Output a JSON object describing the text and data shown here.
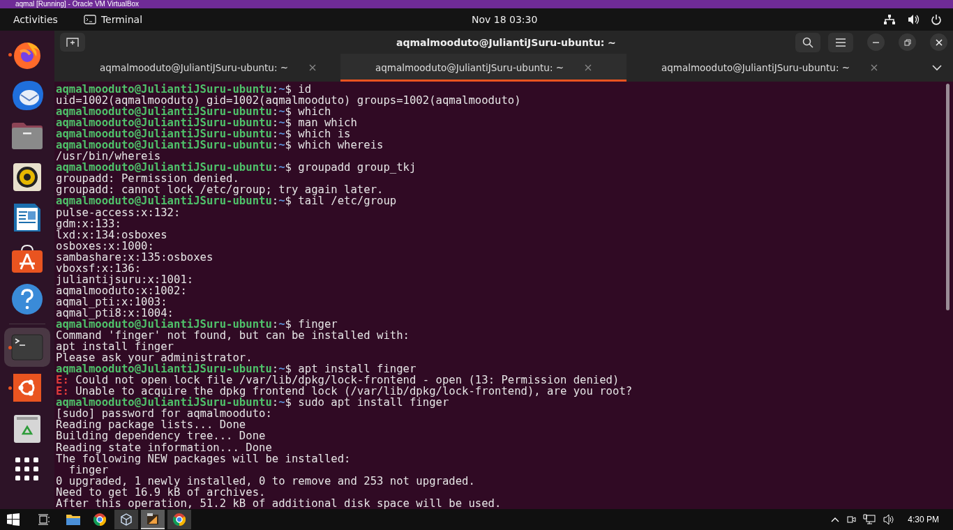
{
  "host_window": {
    "title": "aqmal [Running] - Oracle VM VirtualBox"
  },
  "top_bar": {
    "activities": "Activities",
    "app": "Terminal",
    "clock": "Nov 18  03:30"
  },
  "dock": {
    "items": [
      {
        "kind": "firefox",
        "running": true,
        "selected": false
      },
      {
        "kind": "thunderbird",
        "running": false,
        "selected": false
      },
      {
        "kind": "files",
        "running": false,
        "selected": false
      },
      {
        "kind": "rhythmbox",
        "running": false,
        "selected": false
      },
      {
        "kind": "writer",
        "running": false,
        "selected": false
      },
      {
        "kind": "software",
        "running": false,
        "selected": false
      },
      {
        "kind": "help",
        "running": false,
        "selected": false
      },
      {
        "kind": "terminal",
        "running": true,
        "selected": true
      },
      {
        "kind": "ubuntu",
        "running": true,
        "selected": false
      },
      {
        "kind": "trash",
        "running": false,
        "selected": false
      },
      {
        "kind": "apps",
        "running": false,
        "selected": false
      }
    ]
  },
  "terminal": {
    "title": "aqmalmooduto@JuliantiJSuru-ubuntu: ~",
    "tabs": [
      {
        "label": "aqmalmooduto@JuliantiJSuru-ubuntu: ~",
        "selected": false
      },
      {
        "label": "aqmalmooduto@JuliantiJSuru-ubuntu: ~",
        "selected": true
      },
      {
        "label": "aqmalmooduto@JuliantiJSuru-ubuntu: ~",
        "selected": false
      }
    ],
    "lines": [
      {
        "kind": "prompt",
        "user": "aqmalmooduto@JuliantiJSuru-ubuntu",
        "path": "~",
        "command": "id",
        "sep": ":",
        "sigil": "$"
      },
      {
        "kind": "output",
        "text": "uid=1002(aqmalmooduto) gid=1002(aqmalmooduto) groups=1002(aqmalmooduto)"
      },
      {
        "kind": "prompt",
        "user": "aqmalmooduto@JuliantiJSuru-ubuntu",
        "path": "~",
        "command": "which",
        "sep": ":",
        "sigil": "$"
      },
      {
        "kind": "prompt",
        "user": "aqmalmooduto@JuliantiJSuru-ubuntu",
        "path": "~",
        "command": "man which",
        "sep": ":",
        "sigil": "$"
      },
      {
        "kind": "prompt",
        "user": "aqmalmooduto@JuliantiJSuru-ubuntu",
        "path": "~",
        "command": "which is",
        "sep": ":",
        "sigil": "$"
      },
      {
        "kind": "prompt",
        "user": "aqmalmooduto@JuliantiJSuru-ubuntu",
        "path": "~",
        "command": "which whereis",
        "sep": ":",
        "sigil": "$"
      },
      {
        "kind": "output",
        "text": "/usr/bin/whereis"
      },
      {
        "kind": "prompt",
        "user": "aqmalmooduto@JuliantiJSuru-ubuntu",
        "path": "~",
        "command": "groupadd group_tkj",
        "sep": ":",
        "sigil": "$"
      },
      {
        "kind": "output",
        "text": "groupadd: Permission denied."
      },
      {
        "kind": "output",
        "text": "groupadd: cannot lock /etc/group; try again later."
      },
      {
        "kind": "prompt",
        "user": "aqmalmooduto@JuliantiJSuru-ubuntu",
        "path": "~",
        "command": "tail /etc/group",
        "sep": ":",
        "sigil": "$"
      },
      {
        "kind": "output",
        "text": "pulse-access:x:132:"
      },
      {
        "kind": "output",
        "text": "gdm:x:133:"
      },
      {
        "kind": "output",
        "text": "lxd:x:134:osboxes"
      },
      {
        "kind": "output",
        "text": "osboxes:x:1000:"
      },
      {
        "kind": "output",
        "text": "sambashare:x:135:osboxes"
      },
      {
        "kind": "output",
        "text": "vboxsf:x:136:"
      },
      {
        "kind": "output",
        "text": "juliantijsuru:x:1001:"
      },
      {
        "kind": "output",
        "text": "aqmalmooduto:x:1002:"
      },
      {
        "kind": "output",
        "text": "aqmal_pti:x:1003:"
      },
      {
        "kind": "output",
        "text": "aqmal_pti8:x:1004:"
      },
      {
        "kind": "prompt",
        "user": "aqmalmooduto@JuliantiJSuru-ubuntu",
        "path": "~",
        "command": "finger",
        "sep": ":",
        "sigil": "$"
      },
      {
        "kind": "output",
        "text": "Command 'finger' not found, but can be installed with:"
      },
      {
        "kind": "output",
        "text": "apt install finger"
      },
      {
        "kind": "output",
        "text": "Please ask your administrator."
      },
      {
        "kind": "prompt",
        "user": "aqmalmooduto@JuliantiJSuru-ubuntu",
        "path": "~",
        "command": "apt install finger",
        "sep": ":",
        "sigil": "$"
      },
      {
        "kind": "error",
        "tag": "E:",
        "text": "Could not open lock file /var/lib/dpkg/lock-frontend - open (13: Permission denied)"
      },
      {
        "kind": "error",
        "tag": "E:",
        "text": "Unable to acquire the dpkg frontend lock (/var/lib/dpkg/lock-frontend), are you root?"
      },
      {
        "kind": "prompt",
        "user": "aqmalmooduto@JuliantiJSuru-ubuntu",
        "path": "~",
        "command": "sudo apt install finger",
        "sep": ":",
        "sigil": "$"
      },
      {
        "kind": "output",
        "text": "[sudo] password for aqmalmooduto:"
      },
      {
        "kind": "output",
        "text": "Reading package lists... Done"
      },
      {
        "kind": "output",
        "text": "Building dependency tree... Done"
      },
      {
        "kind": "output",
        "text": "Reading state information... Done"
      },
      {
        "kind": "output",
        "text": "The following NEW packages will be installed:"
      },
      {
        "kind": "output",
        "text": "  finger"
      },
      {
        "kind": "output",
        "text": "0 upgraded, 1 newly installed, 0 to remove and 253 not upgraded."
      },
      {
        "kind": "output",
        "text": "Need to get 16.9 kB of archives."
      },
      {
        "kind": "output",
        "text": "After this operation, 51.2 kB of additional disk space will be used."
      }
    ]
  },
  "taskbar": {
    "apps": [
      {
        "kind": "explorer",
        "selected": false
      },
      {
        "kind": "chrome",
        "selected": false
      },
      {
        "kind": "virtualbox",
        "selected": false
      },
      {
        "kind": "vm",
        "selected": true
      },
      {
        "kind": "chrome-profile",
        "selected": false
      }
    ],
    "time": "4:30 PM"
  }
}
